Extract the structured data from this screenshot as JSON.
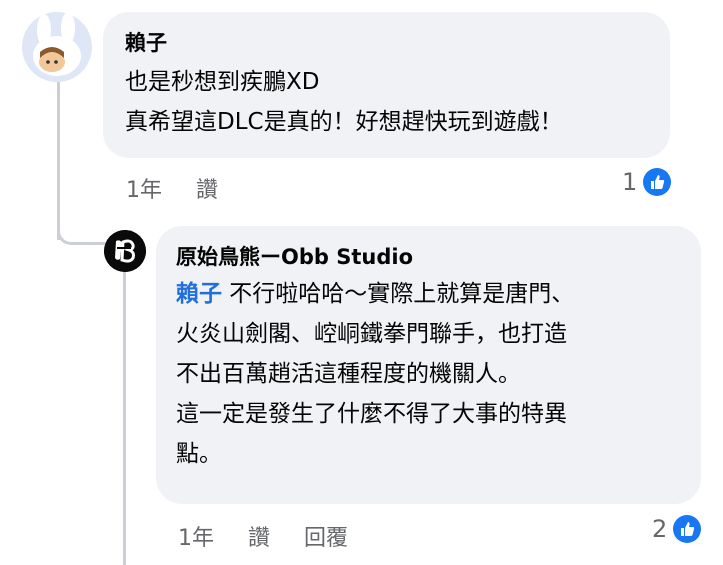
{
  "comments": [
    {
      "author": "賴子",
      "lines": "也是秒想到疾鵬XD\n真希望這DLC是真的！好想趕快玩到遊戲！",
      "time": "1年",
      "like_action": "讚",
      "reaction_count": "1"
    }
  ],
  "reply": {
    "author": "原始鳥熊ーObb Studio",
    "mention": "賴子",
    "text": " 不行啦哈哈～實際上就算是唐門、\n火炎山劍閣、崆峒鐵拳門聯手，也打造\n不出百萬趙活這種程度的機關人。\n這一定是發生了什麼不得了大事的特異\n點。",
    "time": "1年",
    "like_action": "讚",
    "reply_action": "回覆",
    "reaction_count": "2"
  },
  "colors": {
    "bubble": "#f0f2f5",
    "mention": "#216fdb",
    "like_blue": "#1877f2",
    "meta_gray": "#65676b"
  }
}
